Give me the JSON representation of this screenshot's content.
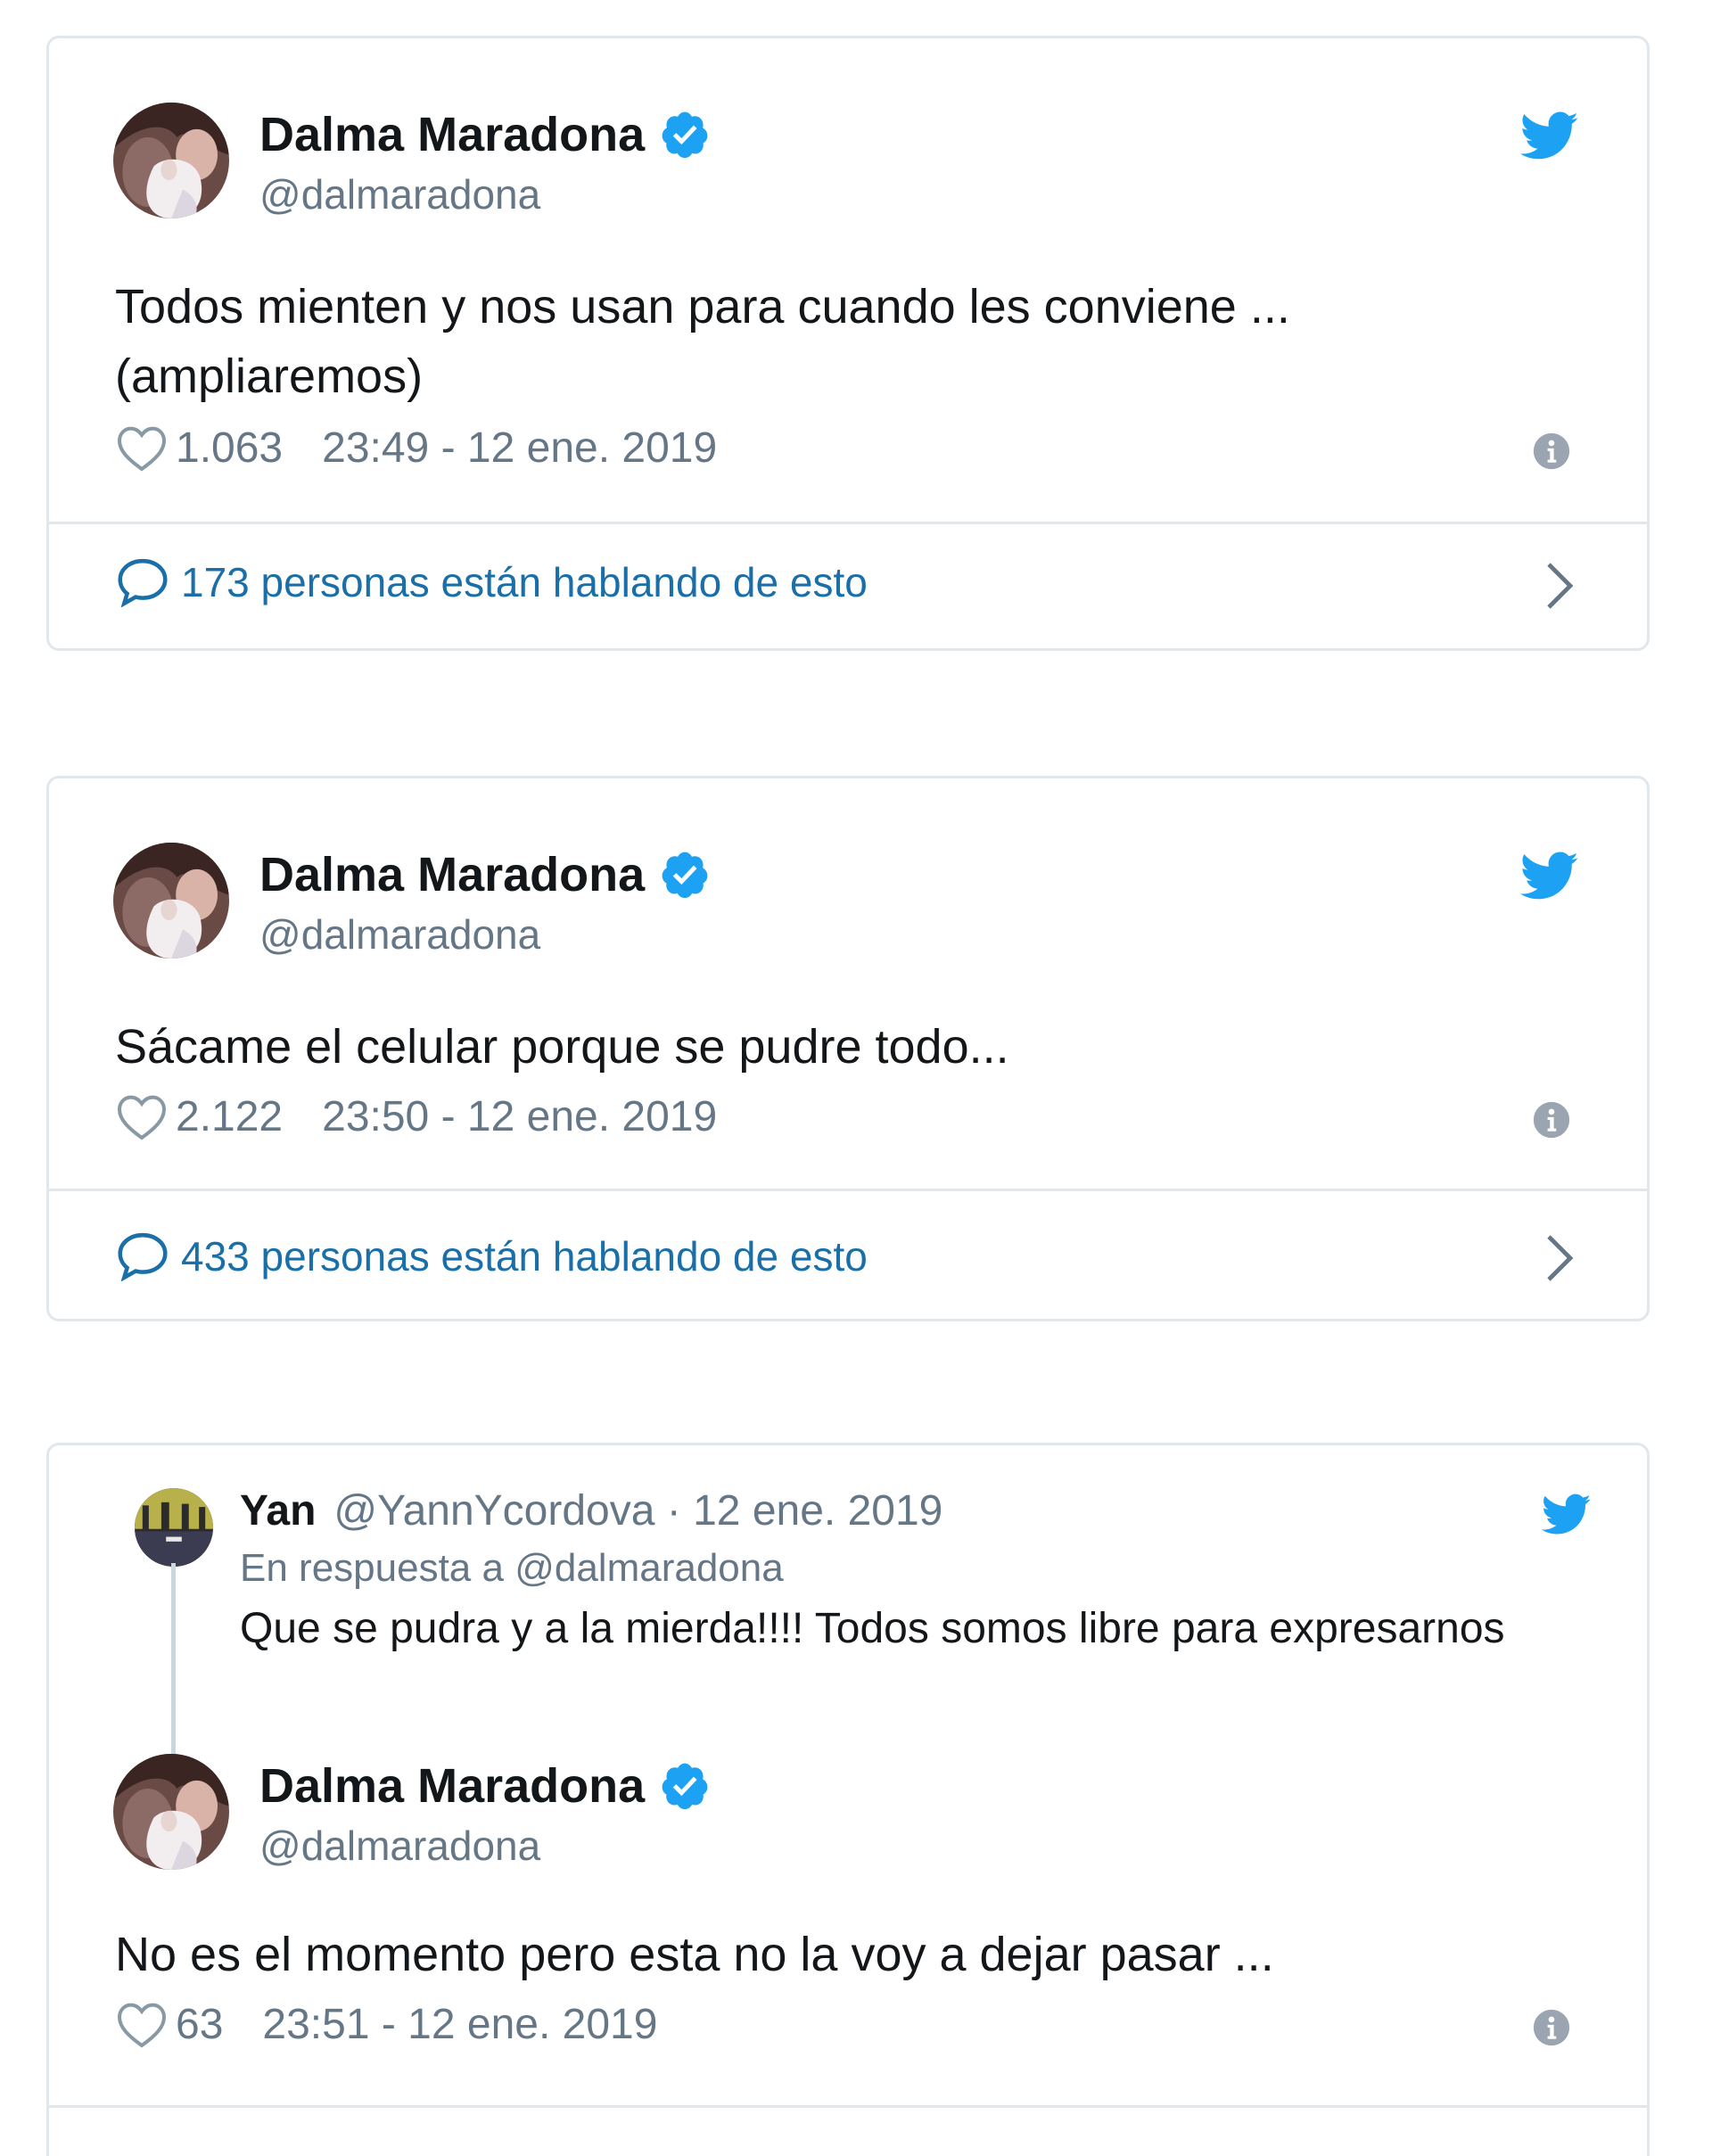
{
  "colors": {
    "twitter_blue": "#1da1f2",
    "link_blue": "#1b6fa8",
    "secondary_gray": "#657786",
    "border": "#e1e8ed"
  },
  "tweets": [
    {
      "author_name": "Dalma Maradona",
      "handle": "@dalmaradona",
      "text_line1": "Todos mienten y nos usan para cuando les conviene ...",
      "text_line2": "(ampliaremos)",
      "likes": "1.063",
      "timestamp": "23:49 - 12 ene. 2019",
      "conversation": "173 personas están hablando de esto",
      "icons": [
        "verified-badge-icon",
        "twitter-bird-icon",
        "heart-icon",
        "info-icon",
        "speech-bubble-icon",
        "chevron-right-icon"
      ]
    },
    {
      "author_name": "Dalma Maradona",
      "handle": "@dalmaradona",
      "text_line1": "Sácame el celular porque se pudre todo...",
      "likes": "2.122",
      "timestamp": "23:50 - 12 ene. 2019",
      "conversation": "433 personas están hablando de esto",
      "icons": [
        "verified-badge-icon",
        "twitter-bird-icon",
        "heart-icon",
        "info-icon",
        "speech-bubble-icon",
        "chevron-right-icon"
      ]
    },
    {
      "reply": {
        "author_name": "Yan",
        "handle_date": "@YannYcordova · 12 ene. 2019",
        "in_reply_to": "En respuesta a @dalmaradona",
        "text": "Que se pudra y a la mierda!!!! Todos somos libre para expresarnos"
      },
      "author_name": "Dalma Maradona",
      "handle": "@dalmaradona",
      "text_line1": "No es el momento pero esta no la voy a dejar pasar ...",
      "likes": "63",
      "timestamp": "23:51 - 12 ene. 2019",
      "icons": [
        "verified-badge-icon",
        "twitter-bird-icon",
        "heart-icon",
        "info-icon"
      ]
    }
  ]
}
